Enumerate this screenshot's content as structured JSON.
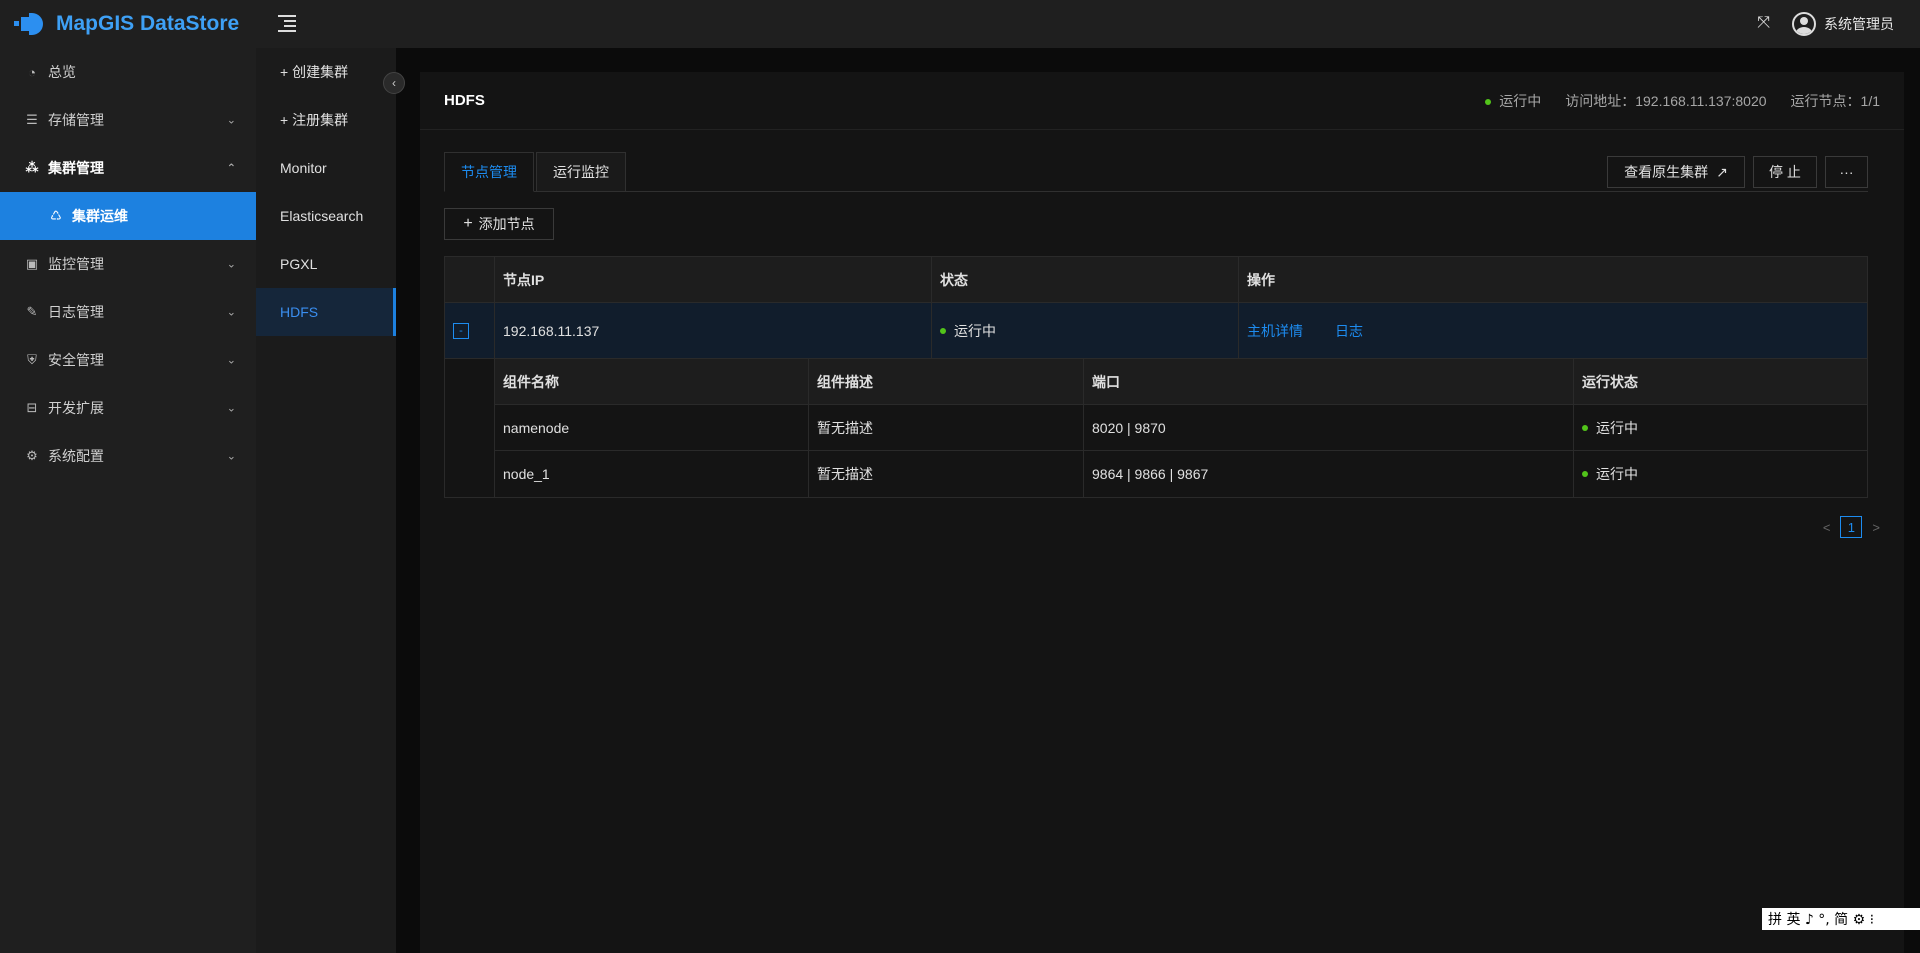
{
  "app": {
    "name": "MapGIS DataStore"
  },
  "sidebar": {
    "items": [
      {
        "label": "总览",
        "icon": "dashboard-icon"
      },
      {
        "label": "存储管理",
        "icon": "storage-icon"
      },
      {
        "label": "集群管理",
        "icon": "cluster-icon"
      },
      {
        "label": "集群运维",
        "icon": "recycle-icon"
      },
      {
        "label": "监控管理",
        "icon": "monitor-icon"
      },
      {
        "label": "日志管理",
        "icon": "log-icon"
      },
      {
        "label": "安全管理",
        "icon": "shield-icon"
      },
      {
        "label": "开发扩展",
        "icon": "toolbox-icon"
      },
      {
        "label": "系统配置",
        "icon": "gear-icon"
      }
    ]
  },
  "cluster_menu": {
    "create": "+ 创建集群",
    "register": "+ 注册集群",
    "items": [
      "Monitor",
      "Elasticsearch",
      "PGXL",
      "HDFS"
    ]
  },
  "header": {
    "user": "系统管理员"
  },
  "panel": {
    "title": "HDFS",
    "status": "运行中",
    "address": "访问地址：192.168.11.137:8020",
    "nodes": "运行节点：1/1"
  },
  "tabs": [
    "节点管理",
    "运行监控"
  ],
  "actions": {
    "view_native": "查看原生集群",
    "stop": "停 止",
    "more": "···",
    "add_node": "添加节点"
  },
  "table": {
    "columns": [
      "节点IP",
      "状态",
      "操作"
    ],
    "row": {
      "ip": "192.168.11.137",
      "status": "运行中",
      "op_detail": "主机详情",
      "op_log": "日志",
      "expand": "-"
    },
    "sub_columns": [
      "组件名称",
      "组件描述",
      "端口",
      "运行状态"
    ],
    "sub_rows": [
      {
        "name": "namenode",
        "desc": "暂无描述",
        "port": "8020 | 9870",
        "status": "运行中"
      },
      {
        "name": "node_1",
        "desc": "暂无描述",
        "port": "9864 | 9866 | 9867",
        "status": "运行中"
      }
    ]
  },
  "pagination": {
    "current": "1",
    "prev": "<",
    "next": ">"
  },
  "ime": {
    "text": "拼 英 ♪ °, 简 ⚙ ⁝"
  },
  "colors": {
    "accent": "#1d81e0",
    "running": "#52c41a"
  }
}
